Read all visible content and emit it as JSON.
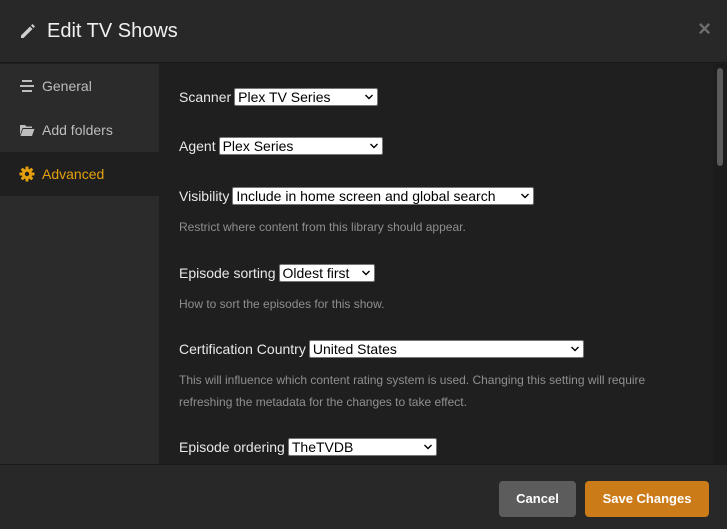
{
  "header": {
    "title": "Edit TV Shows",
    "icon": "pencil-icon",
    "close_label": "×"
  },
  "sidebar": {
    "items": [
      {
        "label": "General",
        "icon": "list-icon",
        "active": false
      },
      {
        "label": "Add folders",
        "icon": "folder-icon",
        "active": false
      },
      {
        "label": "Advanced",
        "icon": "gear-icon",
        "active": true
      }
    ]
  },
  "form": {
    "scanner": {
      "label": "Scanner",
      "value": "Plex TV Series"
    },
    "agent": {
      "label": "Agent",
      "value": "Plex Series"
    },
    "visibility": {
      "label": "Visibility",
      "value": "Include in home screen and global search",
      "hint": "Restrict where content from this library should appear."
    },
    "episode_sorting": {
      "label": "Episode sorting",
      "value": "Oldest first",
      "hint": "How to sort the episodes for this show."
    },
    "certification_country": {
      "label": "Certification Country",
      "value": "United States",
      "hint_line1": "This will influence which content rating system is used. Changing this setting will require",
      "hint_line2": "refreshing the metadata for the changes to take effect."
    },
    "episode_ordering": {
      "label": "Episode ordering",
      "value": "TheTVDB"
    }
  },
  "footer": {
    "cancel_label": "Cancel",
    "save_label": "Save Changes"
  },
  "colors": {
    "accent": "#e5a00d",
    "save_button": "#cc7b19",
    "cancel_button": "#5c5c5c",
    "background": "#1f1f1f",
    "sidebar": "#2b2b2b"
  }
}
